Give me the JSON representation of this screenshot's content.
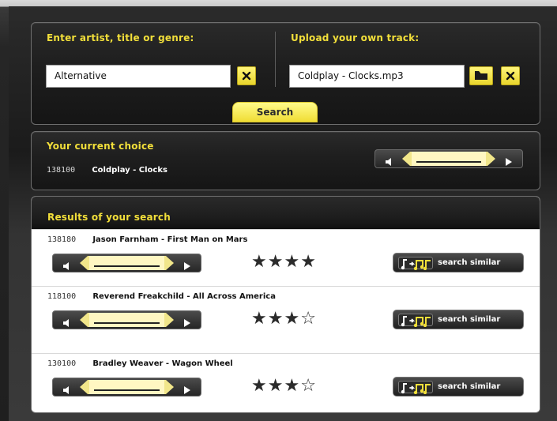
{
  "upload_panel": {
    "left_heading": "Enter artist, title or genre:",
    "search_input_value": "Alternative",
    "right_heading": "Upload your own track:",
    "upload_input_value": "Coldplay - Clocks.mp3",
    "search_tab_label": "Search"
  },
  "current_choice": {
    "heading": "Your current choice",
    "id": "138100",
    "title": "Coldplay - Clocks"
  },
  "results": {
    "heading": "Results of your search",
    "items": [
      {
        "id": "138180",
        "title": "Jason Farnham - First Man on Mars",
        "rating": 4,
        "rating_max": 4,
        "similar_label": "search similar"
      },
      {
        "id": "118100",
        "title": "Reverend Freakchild - All Across America",
        "rating": 3,
        "rating_max": 4,
        "similar_label": "search similar"
      },
      {
        "id": "130100",
        "title": "Bradley Weaver - Wagon Wheel",
        "rating": 3,
        "rating_max": 4,
        "similar_label": "search similar"
      }
    ]
  },
  "colors": {
    "accent_yellow": "#f2df3a",
    "panel_dark": "#1f1f1f"
  },
  "icons": {
    "clear": "close-x-icon",
    "folder": "folder-icon",
    "speaker": "speaker-icon",
    "play": "play-icon",
    "music_notes": "music-notes-icon",
    "star": "star-icon"
  }
}
